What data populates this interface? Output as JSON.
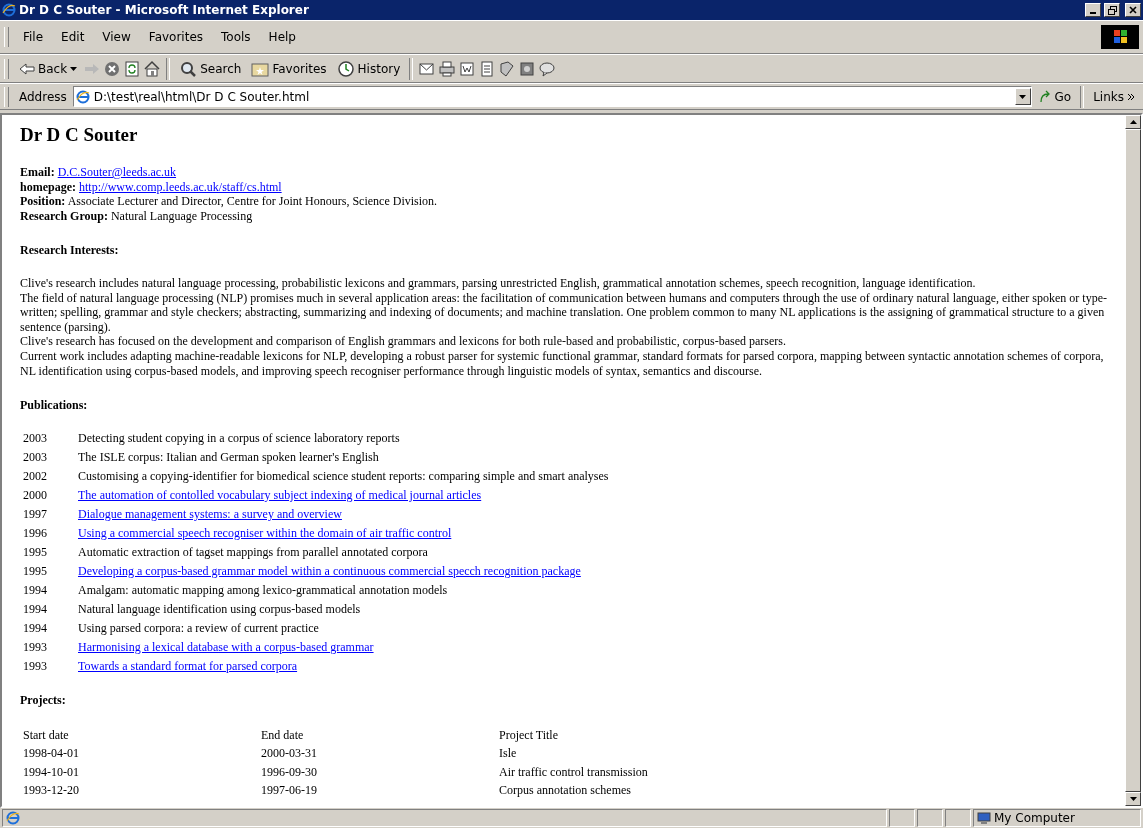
{
  "window": {
    "title": "Dr D C Souter - Microsoft Internet Explorer"
  },
  "menu": [
    "File",
    "Edit",
    "View",
    "Favorites",
    "Tools",
    "Help"
  ],
  "toolbar": {
    "back": "Back",
    "search": "Search",
    "favorites": "Favorites",
    "history": "History"
  },
  "address": {
    "label": "Address",
    "value": "D:\\test\\real\\html\\Dr D C Souter.html",
    "go": "Go",
    "links": "Links"
  },
  "page": {
    "heading": "Dr D C Souter",
    "details": [
      {
        "label": "Email:",
        "value": "D.C.Souter@leeds.ac.uk",
        "link": true
      },
      {
        "label": "homepage:",
        "value": "http://www.comp.leeds.ac.uk/staff/cs.html",
        "link": true
      },
      {
        "label": "Position:",
        "value": "Associate Lecturer and Director, Centre for Joint Honours, Science Division.",
        "link": false
      },
      {
        "label": "Research Group:",
        "value": "Natural Language Processing",
        "link": false
      }
    ],
    "interests_heading": "Research Interests:",
    "interests": [
      "Clive's research includes natural language processing, probabilistic lexicons and grammars, parsing unrestricted English, grammatical annotation schemes, speech recognition, language identification.",
      "The field of natural language processing (NLP) promises much in several application areas: the facilitation of communication between humans and computers through the use of ordinary natural language, either spoken or type-written; spelling, grammar and style checkers; abstracting, summarizing and indexing of documents; and machine translation. One problem common to many NL applications is the assigning of grammatical structure to a given sentence (parsing).",
      "Clive's research has focused on the development and comparison of English grammars and lexicons for both rule-based and probabilistic, corpus-based parsers.",
      "Current work includes adapting machine-readable lexicons for NLP, developing a robust parser for systemic functional grammar, standard formats for parsed corpora, mapping between syntactic annotation schemes of corpora, NL identification using corpus-based models, and improving speech recogniser performance through linguistic models of syntax, semantics and discourse."
    ],
    "publications_heading": "Publications:",
    "publications": [
      {
        "year": "2003",
        "title": "Detecting student copying in a corpus of science laboratory reports",
        "link": false
      },
      {
        "year": "2003",
        "title": "The ISLE corpus: Italian and German spoken learner's English",
        "link": false
      },
      {
        "year": "2002",
        "title": "Customising a copying-identifier for biomedical science student reports: comparing simple and smart analyses",
        "link": false
      },
      {
        "year": "2000",
        "title": "The automation of contolled vocabulary subject indexing of medical journal articles",
        "link": true
      },
      {
        "year": "1997",
        "title": "Dialogue management systems: a survey and overview",
        "link": true
      },
      {
        "year": "1996",
        "title": "Using a commercial speech recogniser within the domain of air traffic control",
        "link": true
      },
      {
        "year": "1995",
        "title": "Automatic extraction of tagset mappings from parallel annotated corpora",
        "link": false
      },
      {
        "year": "1995",
        "title": "Developing a corpus-based grammar model within a continuous commercial specch recognition package",
        "link": true
      },
      {
        "year": "1994",
        "title": "Amalgam: automatic mapping among lexico-grammatical annotation models",
        "link": false
      },
      {
        "year": "1994",
        "title": "Natural language identification using corpus-based models",
        "link": false
      },
      {
        "year": "1994",
        "title": "Using parsed corpora: a review of current practice",
        "link": false
      },
      {
        "year": "1993",
        "title": "Harmonising a lexical database with a corpus-based grammar",
        "link": true
      },
      {
        "year": "1993",
        "title": "Towards a standard format for parsed corpora",
        "link": true
      }
    ],
    "projects_heading": "Projects:",
    "projects": {
      "columns": [
        "Start date",
        "End date",
        "Project Title"
      ],
      "rows": [
        [
          "1998-04-01",
          "2000-03-31",
          "Isle"
        ],
        [
          "1994-10-01",
          "1996-09-30",
          "Air traffic control transmission"
        ],
        [
          "1993-12-20",
          "1997-06-19",
          "Corpus annotation schemes"
        ]
      ]
    }
  },
  "status_bar": {
    "zone": "My Computer"
  }
}
